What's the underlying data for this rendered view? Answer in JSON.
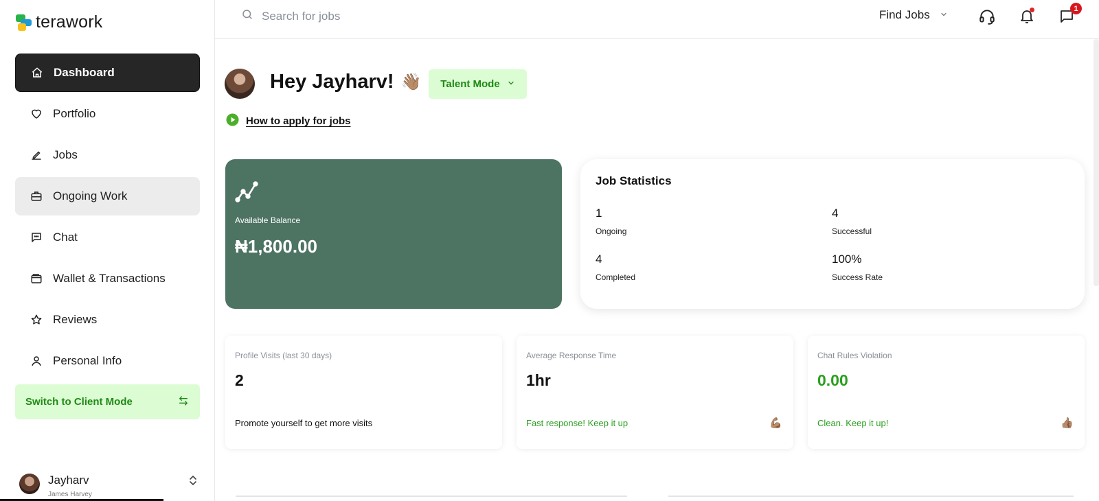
{
  "brand": {
    "name": "terawork"
  },
  "sidebar": {
    "items": [
      {
        "label": "Dashboard",
        "icon": "home-icon"
      },
      {
        "label": "Portfolio",
        "icon": "heart-icon"
      },
      {
        "label": "Jobs",
        "icon": "pencil-icon"
      },
      {
        "label": "Ongoing Work",
        "icon": "briefcase-icon"
      },
      {
        "label": "Chat",
        "icon": "chat-icon"
      },
      {
        "label": "Wallet & Transactions",
        "icon": "wallet-icon"
      },
      {
        "label": "Reviews",
        "icon": "star-icon"
      },
      {
        "label": "Personal Info",
        "icon": "user-icon"
      }
    ],
    "switch_label": "Switch to Client Mode",
    "user": {
      "name": "Jayharv",
      "sub": "James Harvey"
    }
  },
  "header": {
    "search_placeholder": "Search for jobs",
    "find_jobs_label": "Find Jobs",
    "messages_badge": "1"
  },
  "main": {
    "greeting": "Hey Jayharv!",
    "greeting_emoji": "👋🏽",
    "mode_label": "Talent Mode",
    "how_to_label": "How to apply for jobs",
    "balance": {
      "label": "Available Balance",
      "value": "₦1,800.00"
    },
    "job_statistics": {
      "title": "Job Statistics",
      "items": [
        {
          "value": "1",
          "label": "Ongoing"
        },
        {
          "value": "4",
          "label": "Successful"
        },
        {
          "value": "4",
          "label": "Completed"
        },
        {
          "value": "100%",
          "label": "Success Rate"
        }
      ]
    },
    "cards": [
      {
        "label": "Profile Visits (last 30 days)",
        "value": "2",
        "note": "Promote yourself to get more visits",
        "emoji": ""
      },
      {
        "label": "Average Response Time",
        "value": "1hr",
        "note": "Fast response! Keep it up",
        "emoji": "💪🏽"
      },
      {
        "label": "Chat Rules Violation",
        "value": "0.00",
        "note": "Clean. Keep it up!",
        "emoji": "👍🏽"
      }
    ]
  },
  "colors": {
    "accent_green": "#2aa01f",
    "light_green": "#dcfcd4",
    "balance_card": "#4d7363",
    "active_nav": "#262626",
    "badge_red": "#d9161e"
  }
}
